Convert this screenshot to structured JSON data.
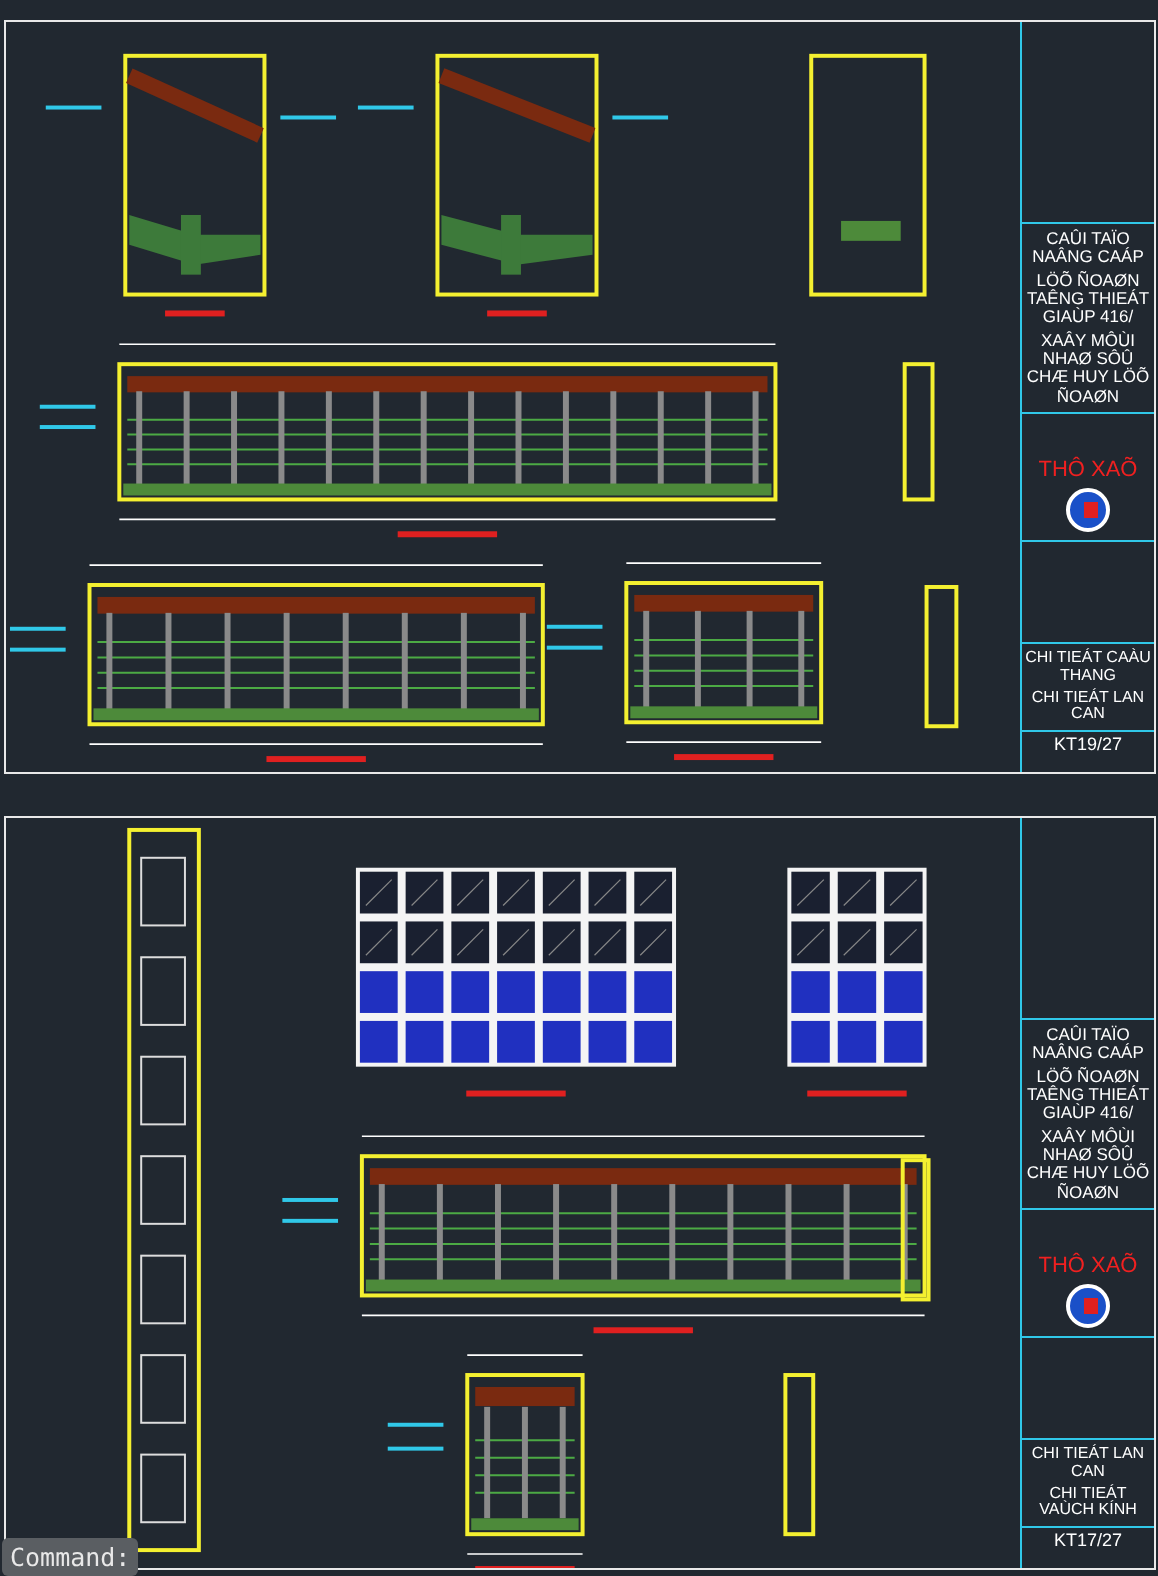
{
  "sheets": [
    {
      "kind": "stairs",
      "title_block": {
        "project": [
          "CAÛI TAÏO NAÂNG CAÁP",
          "LÖÕ ÑOAØN TAÊNG THIEÁT GIAÙP 416/",
          "XAÂY MÔÙI NHAØ SÔÛ CHÆ HUY LÖÕ ÑOAØN"
        ],
        "stamp": "THÔ XAÕ",
        "drawing_title": [
          "CHI TIEÁT CAÀU THANG",
          "CHI TIEÁT LAN CAN"
        ],
        "sheet_number": "KT19/27"
      }
    },
    {
      "kind": "glass",
      "title_block": {
        "project": [
          "CAÛI TAÏO NAÂNG CAÁP",
          "LÖÕ ÑOAØN TAÊNG THIEÁT GIAÙP 416/",
          "XAÂY MÔÙI NHAØ SÔÛ CHÆ HUY LÖÕ ÑOAØN"
        ],
        "stamp": "THÔ XAÕ",
        "drawing_title": [
          "CHI TIEÁT LAN CAN",
          "CHI TIEÁT VAÙCH KÍNH"
        ],
        "sheet_number": "KT17/27"
      }
    }
  ],
  "command_line": {
    "prompt": "Command:"
  }
}
